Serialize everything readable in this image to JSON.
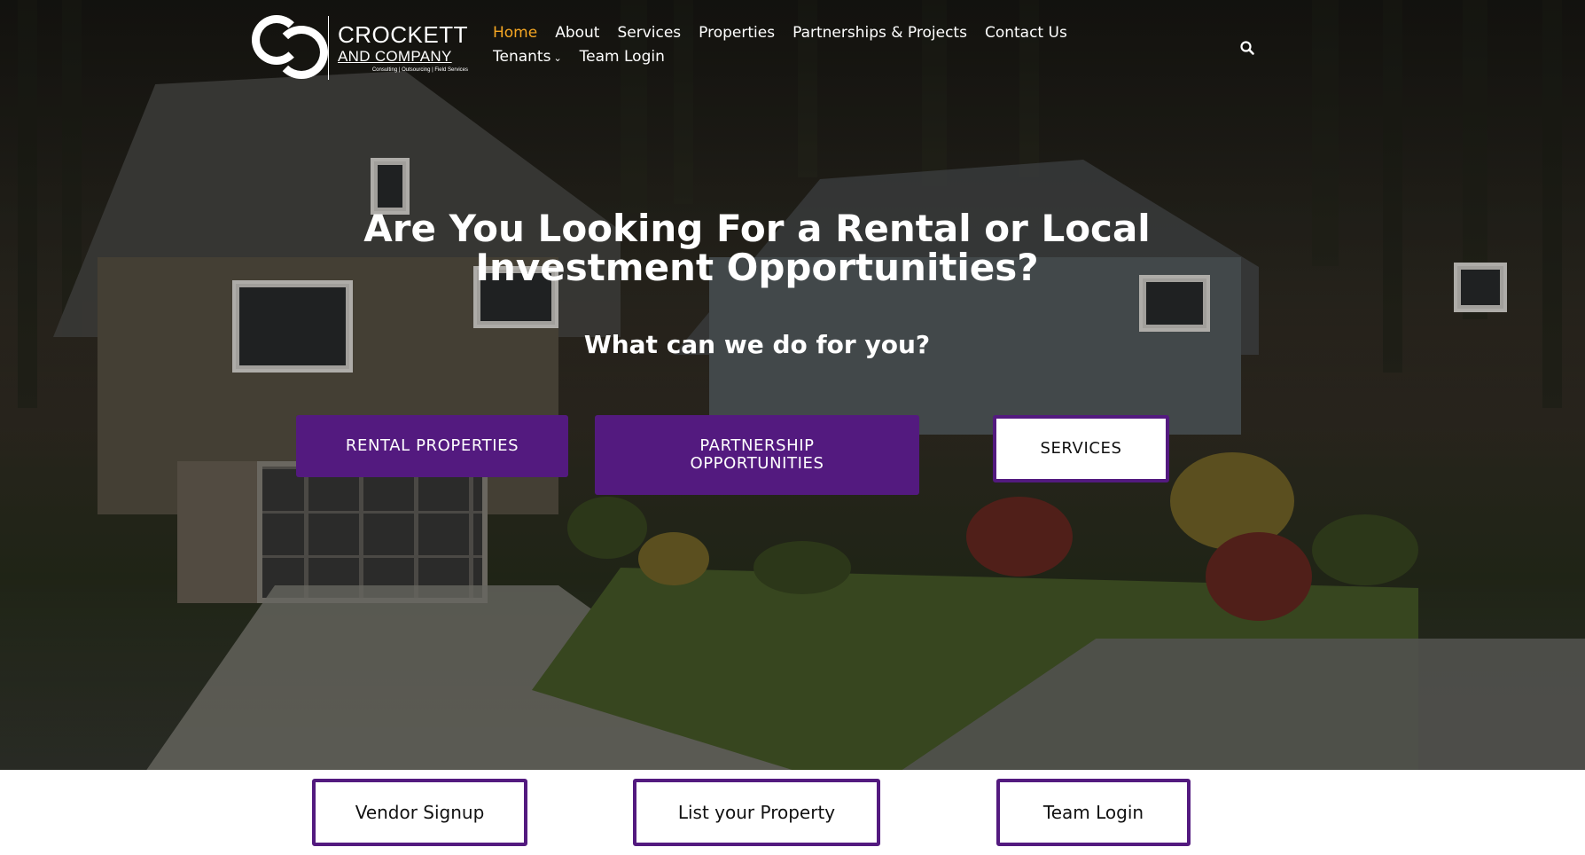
{
  "brand": {
    "name_line1": "CROCKETT",
    "name_line2": "AND COMPANY",
    "tagline": "Consulting | Outsourcing | Field Services"
  },
  "nav": {
    "items": [
      {
        "label": "Home",
        "active": true
      },
      {
        "label": "About"
      },
      {
        "label": "Services"
      },
      {
        "label": "Properties"
      },
      {
        "label": "Partnerships & Projects"
      },
      {
        "label": "Contact Us"
      },
      {
        "label": "Tenants",
        "has_dropdown": true
      },
      {
        "label": "Team Login"
      }
    ],
    "search_icon": "search-icon"
  },
  "hero": {
    "headline": "Are You Looking For a Rental or Local Investment Opportunities?",
    "subhead": "What can we do for you?",
    "buttons": {
      "rental": "RENTAL PROPERTIES",
      "partnership": "PARTNERSHIP OPPORTUNITIES",
      "services": "SERVICES"
    }
  },
  "footer_buttons": {
    "vendor": "Vendor Signup",
    "list_property": "List your Property",
    "team_login": "Team Login"
  },
  "colors": {
    "accent_purple": "#531a7f",
    "nav_active": "#f5a623",
    "text_white": "#ffffff"
  }
}
